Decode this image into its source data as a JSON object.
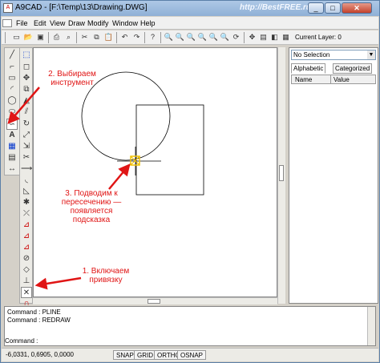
{
  "window": {
    "title": "A9CAD - [F:\\Temp\\13\\Drawing.DWG]",
    "watermark": "http://BestFREE.ru",
    "min": "_",
    "max": "□",
    "close": "✕"
  },
  "menu": [
    {
      "label": "File"
    },
    {
      "label": "Edit"
    },
    {
      "label": "View"
    },
    {
      "label": "Draw"
    },
    {
      "label": "Modify"
    },
    {
      "label": "Window"
    },
    {
      "label": "Help"
    }
  ],
  "toolbar": {
    "current_layer_label": "Current Layer: 0"
  },
  "properties": {
    "selection": "No Selection",
    "tabs": [
      "Alphabetic",
      "Categorized"
    ],
    "columns": [
      "Name",
      "Value"
    ]
  },
  "command": {
    "history": [
      "Command : PLINE",
      "Command : REDRAW"
    ],
    "prompt": "Command :"
  },
  "status": {
    "coords": "-6,0331, 0,6905, 0,0000",
    "buttons": [
      "SNAP",
      "GRID",
      "ORTHO",
      "OSNAP"
    ]
  },
  "annotations": {
    "step2": [
      "2. Выбираем",
      "инструмент"
    ],
    "step3": [
      "3. Подводим к",
      "пересечению —",
      "появляется",
      "подсказка"
    ],
    "step1": [
      "1. Включаем",
      "привязку"
    ]
  },
  "colors": {
    "annotation": "#e01515",
    "titlebar": "#8fb0d6",
    "snap_marker": "#f2c200"
  }
}
